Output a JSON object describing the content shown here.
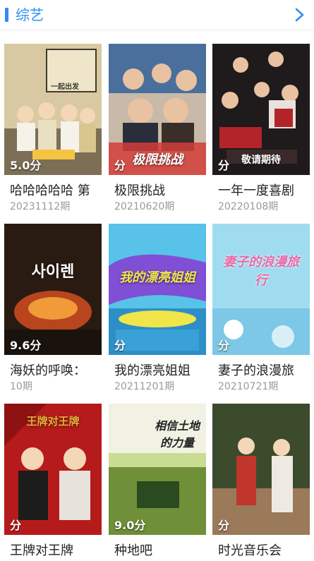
{
  "section": {
    "title": "综艺"
  },
  "shows": [
    {
      "name": "哈哈哈哈哈 第",
      "episode": "20231112期",
      "score": "5.0分",
      "poster_text": "一起出发",
      "colors": [
        "#7d6f55",
        "#d8c9a3",
        "#3d3a30"
      ]
    },
    {
      "name": "极限挑战",
      "episode": "20210620期",
      "score": "分",
      "poster_text": "极限挑战",
      "colors": [
        "#4a6f9c",
        "#c8b9a8",
        "#d23d3a"
      ]
    },
    {
      "name": "一年一度喜剧",
      "episode": "20220108期",
      "score": "分",
      "poster_text": "敬请期待",
      "colors": [
        "#1f1a1c",
        "#b3242a",
        "#e8e2db"
      ]
    },
    {
      "name": "海妖的呼唤：",
      "episode": "10期",
      "score": "9.6分",
      "poster_text": "사이렌",
      "colors": [
        "#2a1b12",
        "#b8451e",
        "#f09a3a"
      ]
    },
    {
      "name": "我的漂亮姐姐",
      "episode": "20211201期",
      "score": "分",
      "poster_text": "我的漂亮姐姐",
      "colors": [
        "#58c2e8",
        "#7f4fd6",
        "#f0e64a"
      ]
    },
    {
      "name": "妻子的浪漫旅",
      "episode": "20210721期",
      "score": "分",
      "poster_text": "妻子的浪漫旅行",
      "colors": [
        "#9fdcf0",
        "#e86aa7",
        "#ffffff"
      ]
    },
    {
      "name": "王牌对王牌",
      "episode": "",
      "score": "分",
      "poster_text": "王牌对王牌",
      "colors": [
        "#b51b1b",
        "#e4b23a",
        "#1c1c1c"
      ]
    },
    {
      "name": "种地吧",
      "episode": "",
      "score": "9.0分",
      "poster_text": "相信土地的力量",
      "colors": [
        "#6f8f38",
        "#c9dc93",
        "#f1f2e4"
      ]
    },
    {
      "name": "时光音乐会",
      "episode": "",
      "score": "分",
      "poster_text": "",
      "colors": [
        "#3b4b2c",
        "#9b7a5a",
        "#c0362c"
      ]
    }
  ]
}
